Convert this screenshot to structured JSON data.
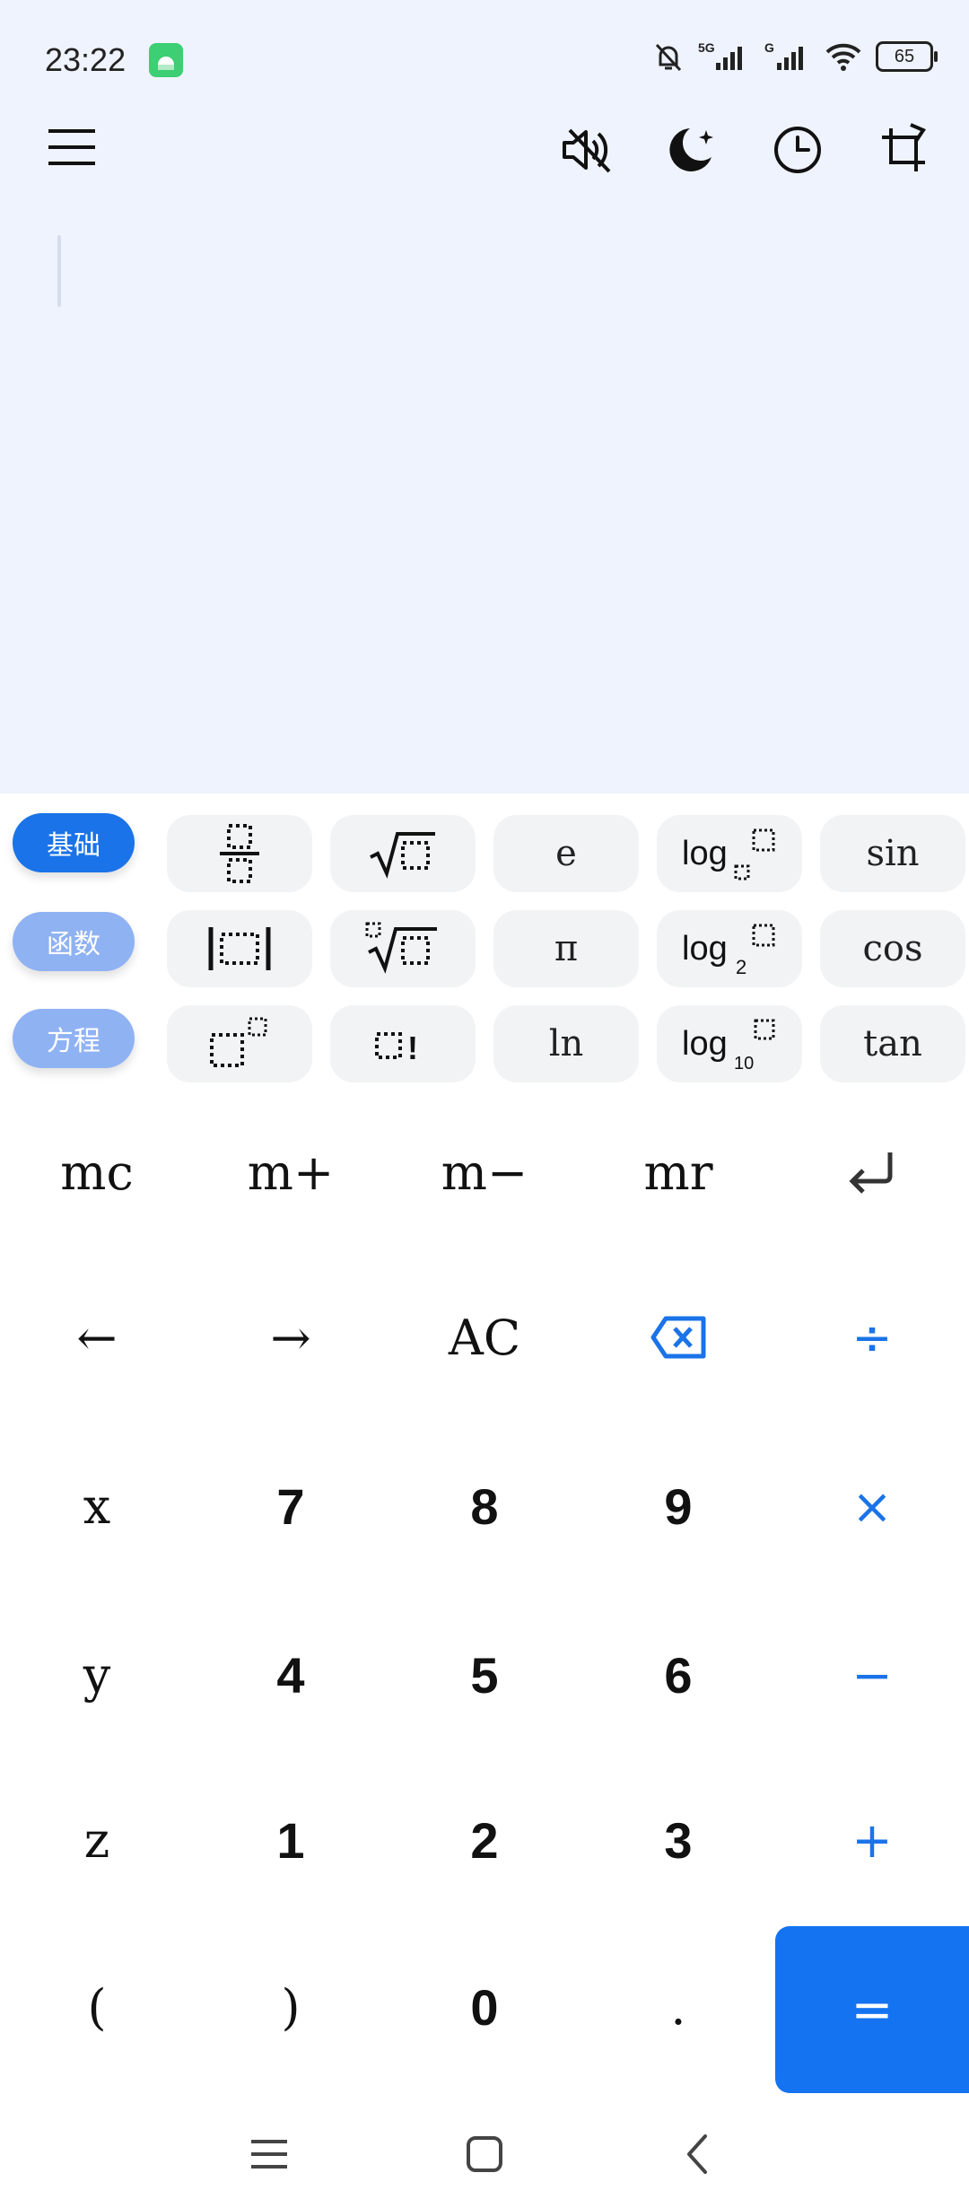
{
  "status_bar": {
    "time": "23:22",
    "battery": "65",
    "icons": [
      "android-notification-icon",
      "mute-bell-icon",
      "5g-signal-icon",
      "g-signal-icon",
      "wifi-icon",
      "battery-icon"
    ]
  },
  "toolbar": {
    "icons": [
      "menu-icon",
      "sound-off-icon",
      "night-mode-icon",
      "history-icon",
      "rotate-icon"
    ]
  },
  "modes": [
    {
      "label": "基础",
      "active": true
    },
    {
      "label": "函数",
      "active": false
    },
    {
      "label": "方程",
      "active": false
    }
  ],
  "function_keys": {
    "row1": [
      "fraction-template-icon",
      "sqrt-template-icon",
      "e",
      "log-base-template-icon",
      "sin"
    ],
    "row2": [
      "abs-template-icon",
      "nth-root-template-icon",
      "π",
      "log2-template-icon",
      "cos"
    ],
    "row3": [
      "power-template-icon",
      "factorial-template-icon",
      "ln",
      "log10-template-icon",
      "tan"
    ],
    "log_subscripts": {
      "log2": "2",
      "log10": "10"
    },
    "factorial_mark": "!"
  },
  "memory_row": [
    "mc",
    "m+",
    "m−",
    "mr"
  ],
  "keypad": {
    "row_nav": [
      "←",
      "→",
      "AC"
    ],
    "vars": [
      "x",
      "y",
      "z"
    ],
    "digits_row1": [
      "7",
      "8",
      "9"
    ],
    "digits_row2": [
      "4",
      "5",
      "6"
    ],
    "digits_row3": [
      "1",
      "2",
      "3"
    ],
    "bottom": [
      "(",
      ")",
      "0",
      "."
    ],
    "operators": {
      "divide": "÷",
      "multiply": "×",
      "minus": "−",
      "plus": "+",
      "equals": "="
    }
  },
  "colors": {
    "accent": "#1a73e8",
    "equals_bg": "#1473f0",
    "mode_inactive": "#8fb2f3",
    "display_bg": "#eff3fd",
    "fn_key_bg": "#f2f3f5"
  }
}
